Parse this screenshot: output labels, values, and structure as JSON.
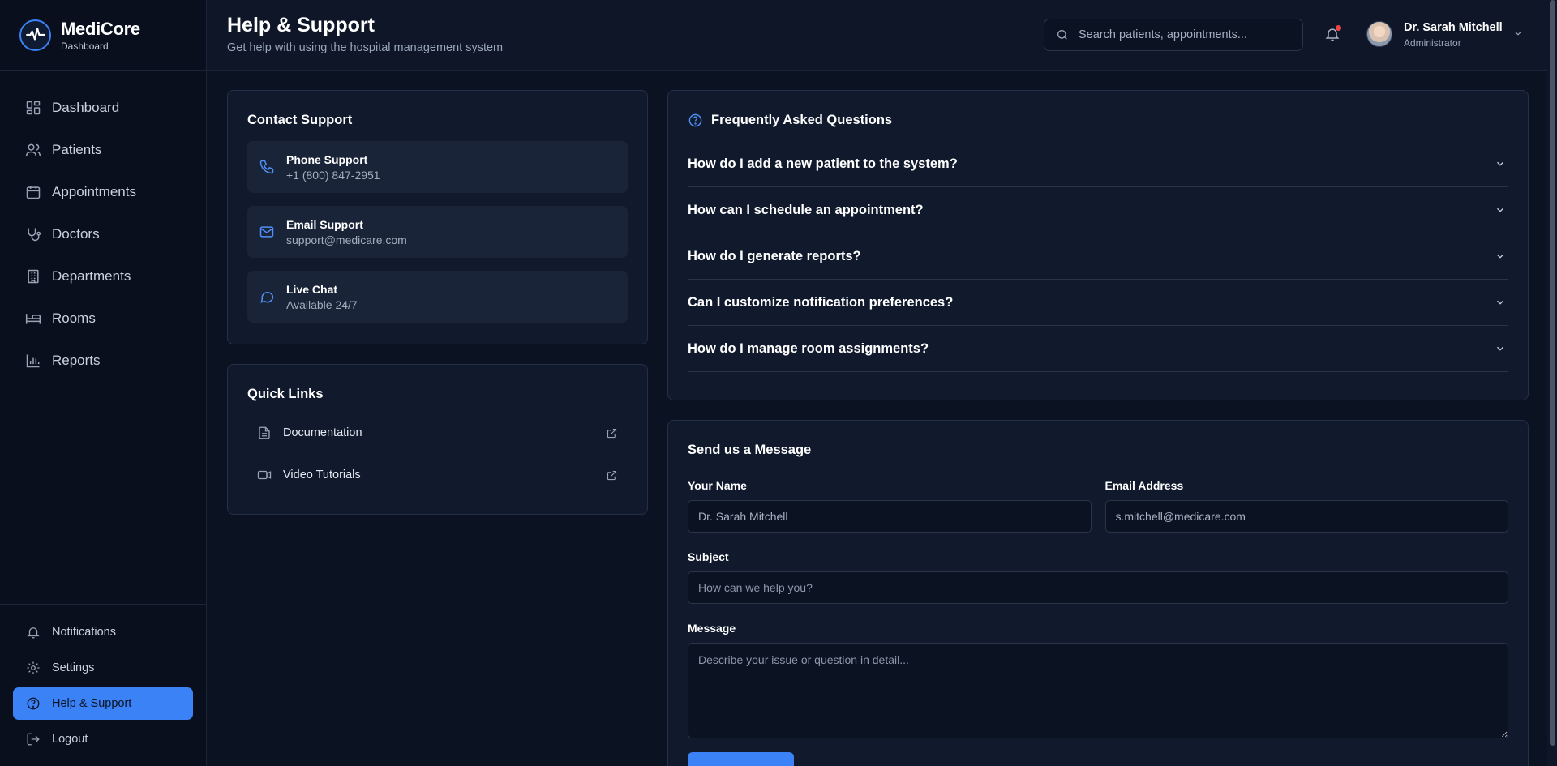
{
  "brand": {
    "name": "MediCore",
    "subtitle": "Dashboard"
  },
  "nav": {
    "items": [
      {
        "label": "Dashboard",
        "icon": "dashboard-icon"
      },
      {
        "label": "Patients",
        "icon": "users-icon"
      },
      {
        "label": "Appointments",
        "icon": "calendar-icon"
      },
      {
        "label": "Doctors",
        "icon": "stethoscope-icon"
      },
      {
        "label": "Departments",
        "icon": "building-icon"
      },
      {
        "label": "Rooms",
        "icon": "bed-icon"
      },
      {
        "label": "Reports",
        "icon": "bar-chart-icon"
      }
    ],
    "bottom": [
      {
        "label": "Notifications",
        "icon": "bell-icon"
      },
      {
        "label": "Settings",
        "icon": "gear-icon"
      },
      {
        "label": "Help & Support",
        "icon": "help-circle-icon",
        "active": true
      },
      {
        "label": "Logout",
        "icon": "logout-icon"
      }
    ]
  },
  "header": {
    "title": "Help & Support",
    "subtitle": "Get help with using the hospital management system",
    "search_placeholder": "Search patients, appointments...",
    "user": {
      "name": "Dr. Sarah Mitchell",
      "role": "Administrator"
    }
  },
  "contact": {
    "title": "Contact Support",
    "items": [
      {
        "title": "Phone Support",
        "value": "+1 (800) 847-2951",
        "icon": "phone-icon"
      },
      {
        "title": "Email Support",
        "value": "support@medicare.com",
        "icon": "mail-icon"
      },
      {
        "title": "Live Chat",
        "value": "Available 24/7",
        "icon": "chat-icon"
      }
    ]
  },
  "quick_links": {
    "title": "Quick Links",
    "items": [
      {
        "label": "Documentation",
        "icon": "file-text-icon"
      },
      {
        "label": "Video Tutorials",
        "icon": "video-icon"
      }
    ]
  },
  "faq": {
    "title": "Frequently Asked Questions",
    "items": [
      "How do I add a new patient to the system?",
      "How can I schedule an appointment?",
      "How do I generate reports?",
      "Can I customize notification preferences?",
      "How do I manage room assignments?"
    ]
  },
  "message_form": {
    "title": "Send us a Message",
    "name_label": "Your Name",
    "name_value": "Dr. Sarah Mitchell",
    "email_label": "Email Address",
    "email_value": "s.mitchell@medicare.com",
    "subject_label": "Subject",
    "subject_placeholder": "How can we help you?",
    "message_label": "Message",
    "message_placeholder": "Describe your issue or question in detail..."
  },
  "colors": {
    "accent": "#3b82f6",
    "background": "#0b1222",
    "card": "#111a2d",
    "notification_dot": "#ef4444"
  }
}
